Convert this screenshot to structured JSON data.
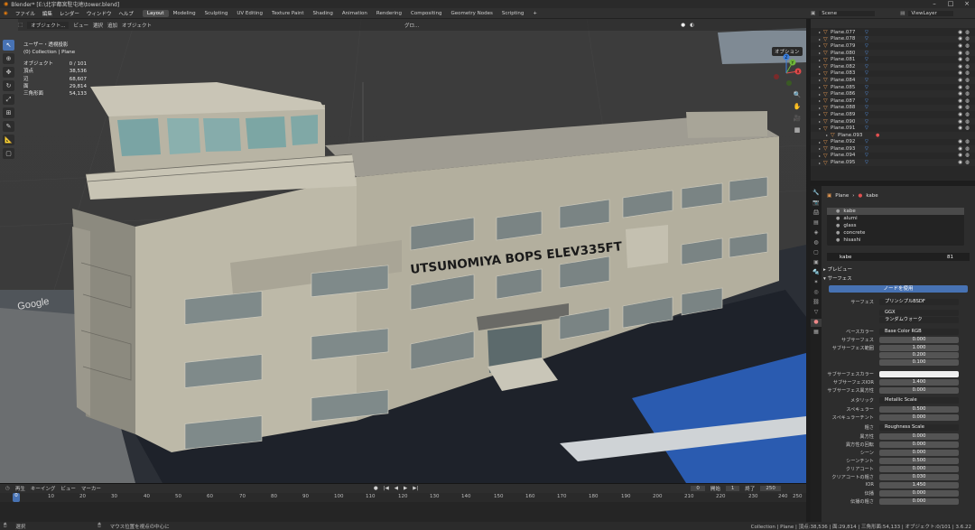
{
  "title_bar": {
    "title": "Blender* [E:\\北宇都宮駐屯地\\tower.blend]"
  },
  "menu": {
    "items": [
      "ファイル",
      "編集",
      "レンダー",
      "ウィンドウ",
      "ヘルプ"
    ],
    "workspaces": [
      "Layout",
      "Modeling",
      "Sculpting",
      "UV Editing",
      "Texture Paint",
      "Shading",
      "Animation",
      "Rendering",
      "Compositing",
      "Geometry Nodes",
      "Scripting"
    ],
    "add_tab": "+",
    "scene": "Scene",
    "view_layer": "ViewLayer"
  },
  "viewport_header": {
    "mode": "オブジェクト...",
    "view": "ビュー",
    "select": "選択",
    "add": "追加",
    "object": "オブジェクト",
    "transform": "グロ...",
    "options": "オプション"
  },
  "stats": {
    "view_name": "ユーザー・透視投影",
    "collection": "(0) Collection | Plane",
    "rows": [
      {
        "label": "オブジェクト",
        "value": "0 / 101"
      },
      {
        "label": "頂点",
        "value": "38,536"
      },
      {
        "label": "辺",
        "value": "68,607"
      },
      {
        "label": "面",
        "value": "29,814"
      },
      {
        "label": "三角形面",
        "value": "54,133"
      }
    ]
  },
  "building_sign": "UTSUNOMIYA  BOPS  ELEV335FT",
  "map_watermark": "Google",
  "gizmo": {
    "x": "X",
    "y": "Y",
    "z": "Z"
  },
  "timeline": {
    "header": [
      "再生",
      "キーイング",
      "ビュー",
      "マーカー"
    ],
    "current_frame": "0",
    "start_label": "開始",
    "start": "1",
    "end_label": "終了",
    "end": "250",
    "ticks": [
      "10",
      "20",
      "30",
      "40",
      "50",
      "60",
      "70",
      "80",
      "90",
      "100",
      "110",
      "120",
      "130",
      "140",
      "150",
      "160",
      "170",
      "180",
      "190",
      "200",
      "210",
      "220",
      "230",
      "240",
      "250"
    ],
    "playhead": "0"
  },
  "statusbar": {
    "select": "選択",
    "hint": "マウス位置を視点の中心に",
    "info": "Collection | Plane | 頂点:38,536 | 面:29,814 | 三角形面:54,133 | オブジェクト:0/101 | 3.6.22"
  },
  "outliner": {
    "items": [
      "Plane.077",
      "Plane.078",
      "Plane.079",
      "Plane.080",
      "Plane.081",
      "Plane.082",
      "Plane.083",
      "Plane.084",
      "Plane.085",
      "Plane.086",
      "Plane.087",
      "Plane.088",
      "Plane.089",
      "Plane.090",
      "Plane.091",
      "Plane.093",
      "Plane.092",
      "Plane.093",
      "Plane.094",
      "Plane.095"
    ]
  },
  "properties": {
    "breadcrumb": [
      "Plane",
      "kabe"
    ],
    "slots": [
      "kabe",
      "alumi",
      "glass",
      "concrete",
      "hisashi"
    ],
    "material_name": "kabe",
    "users": "81",
    "preview_label": "プレビュー",
    "surface_label": "サーフェス",
    "use_nodes": "ノードを使用",
    "rows": [
      {
        "label": "サーフェス",
        "value": "プリンシプルBSDF",
        "kind": "dark"
      },
      {
        "label": "",
        "value": "GGX",
        "kind": "dark"
      },
      {
        "label": "",
        "value": "ランダムウォーク",
        "kind": "dark"
      },
      {
        "label": "ベースカラー",
        "value": "Base Color RGB",
        "kind": "dark"
      },
      {
        "label": "サブサーフェス",
        "value": "0.000",
        "kind": "num",
        "fill": 0
      },
      {
        "label": "サブサーフェス範囲",
        "value": "1.000",
        "kind": "num",
        "fill": 0
      },
      {
        "label": "",
        "value": "0.200",
        "kind": "num",
        "fill": 0
      },
      {
        "label": "",
        "value": "0.100",
        "kind": "num",
        "fill": 0
      },
      {
        "label": "サブサーフェスカラー",
        "value": "",
        "kind": "white"
      },
      {
        "label": "サブサーフェスIOR",
        "value": "1.400",
        "kind": "num",
        "fill": 0.1
      },
      {
        "label": "サブサーフェス異方性",
        "value": "0.000",
        "kind": "num",
        "fill": 0
      },
      {
        "label": "メタリック",
        "value": "Metallic Scale",
        "kind": "dark"
      },
      {
        "label": "スペキュラー",
        "value": "0.500",
        "kind": "num",
        "fill": 0.5
      },
      {
        "label": "スペキュラーチント",
        "value": "0.000",
        "kind": "num",
        "fill": 0
      },
      {
        "label": "粗さ",
        "value": "Roughness Scale",
        "kind": "dark"
      },
      {
        "label": "異方性",
        "value": "0.000",
        "kind": "num",
        "fill": 0
      },
      {
        "label": "異方性の回転",
        "value": "0.000",
        "kind": "num",
        "fill": 0
      },
      {
        "label": "シーン",
        "value": "0.000",
        "kind": "num",
        "fill": 0
      },
      {
        "label": "シーンチント",
        "value": "0.500",
        "kind": "num",
        "fill": 0.5
      },
      {
        "label": "クリアコート",
        "value": "0.000",
        "kind": "num",
        "fill": 0
      },
      {
        "label": "クリアコートの粗さ",
        "value": "0.030",
        "kind": "num",
        "fill": 0.05
      },
      {
        "label": "IOR",
        "value": "1.450",
        "kind": "num",
        "fill": 0
      },
      {
        "label": "伝播",
        "value": "0.000",
        "kind": "num",
        "fill": 0
      },
      {
        "label": "伝播の粗さ",
        "value": "0.000",
        "kind": "num",
        "fill": 0
      }
    ]
  }
}
